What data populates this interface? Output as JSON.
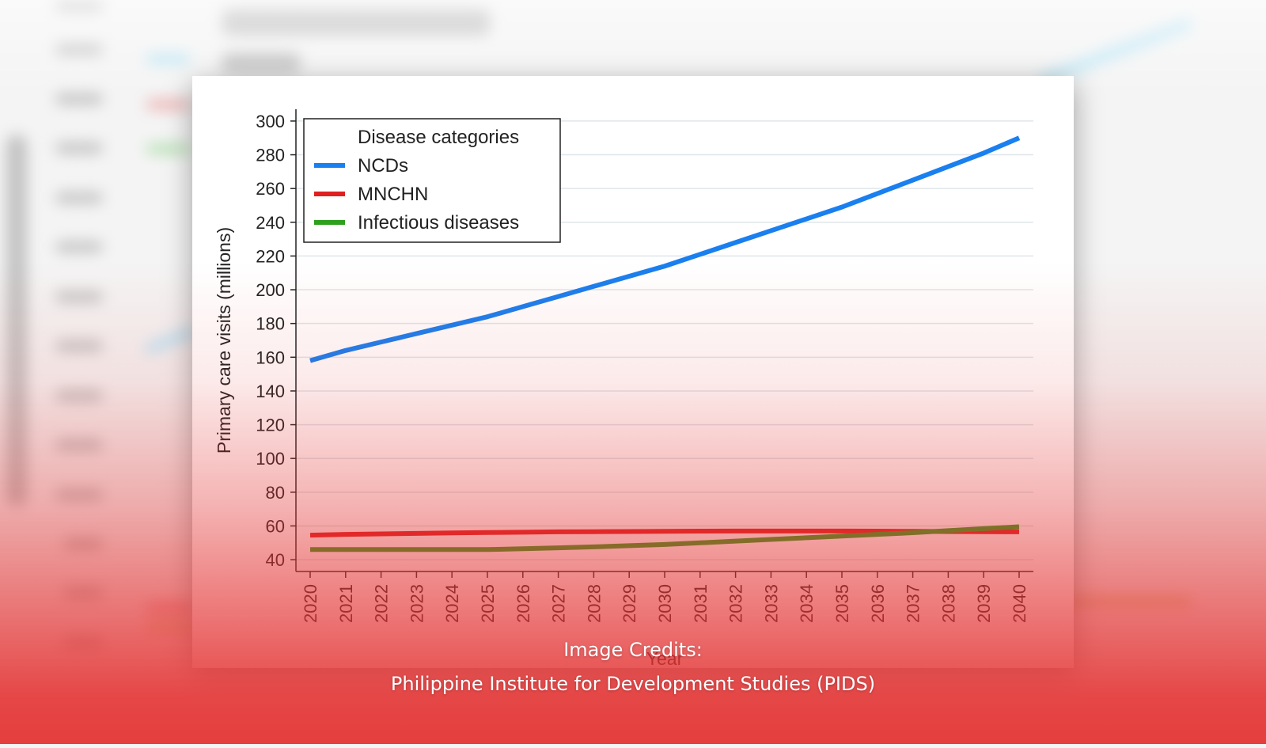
{
  "chart_data": {
    "type": "line",
    "ylabel": "Primary care visits (millions)",
    "xlabel": "Year",
    "x": [
      2020,
      2021,
      2022,
      2023,
      2024,
      2025,
      2026,
      2027,
      2028,
      2029,
      2030,
      2031,
      2032,
      2033,
      2034,
      2035,
      2036,
      2037,
      2038,
      2039,
      2040
    ],
    "ylim": [
      33,
      307
    ],
    "yticks": [
      40,
      60,
      80,
      100,
      120,
      140,
      160,
      180,
      200,
      220,
      240,
      260,
      280,
      300
    ],
    "grid": true,
    "legend": {
      "title": "Disease categories",
      "position": "top-left"
    },
    "series": [
      {
        "name": "NCDs",
        "color": "#1a7fef",
        "values": [
          158,
          164,
          169,
          174,
          179,
          184,
          190,
          196,
          202,
          208,
          214,
          221,
          228,
          235,
          242,
          249,
          257,
          265,
          273,
          281,
          290
        ]
      },
      {
        "name": "MNCHN",
        "color": "#e02020",
        "values": [
          54.5,
          55,
          55.3,
          55.6,
          55.9,
          56.1,
          56.3,
          56.5,
          56.6,
          56.7,
          56.8,
          56.9,
          57,
          57,
          57,
          57,
          56.9,
          56.8,
          56.7,
          56.6,
          56.5
        ]
      },
      {
        "name": "Infectious diseases",
        "color": "#2ea01e",
        "values": [
          46,
          46,
          46,
          46,
          46,
          46,
          46.5,
          47,
          47.6,
          48.3,
          49,
          50,
          51,
          52,
          53,
          54,
          55,
          56,
          57.2,
          58.4,
          59.5
        ]
      }
    ]
  },
  "credits": {
    "line1": "Image Credits:",
    "line2": "Philippine Institute for Development Studies (PIDS)"
  }
}
